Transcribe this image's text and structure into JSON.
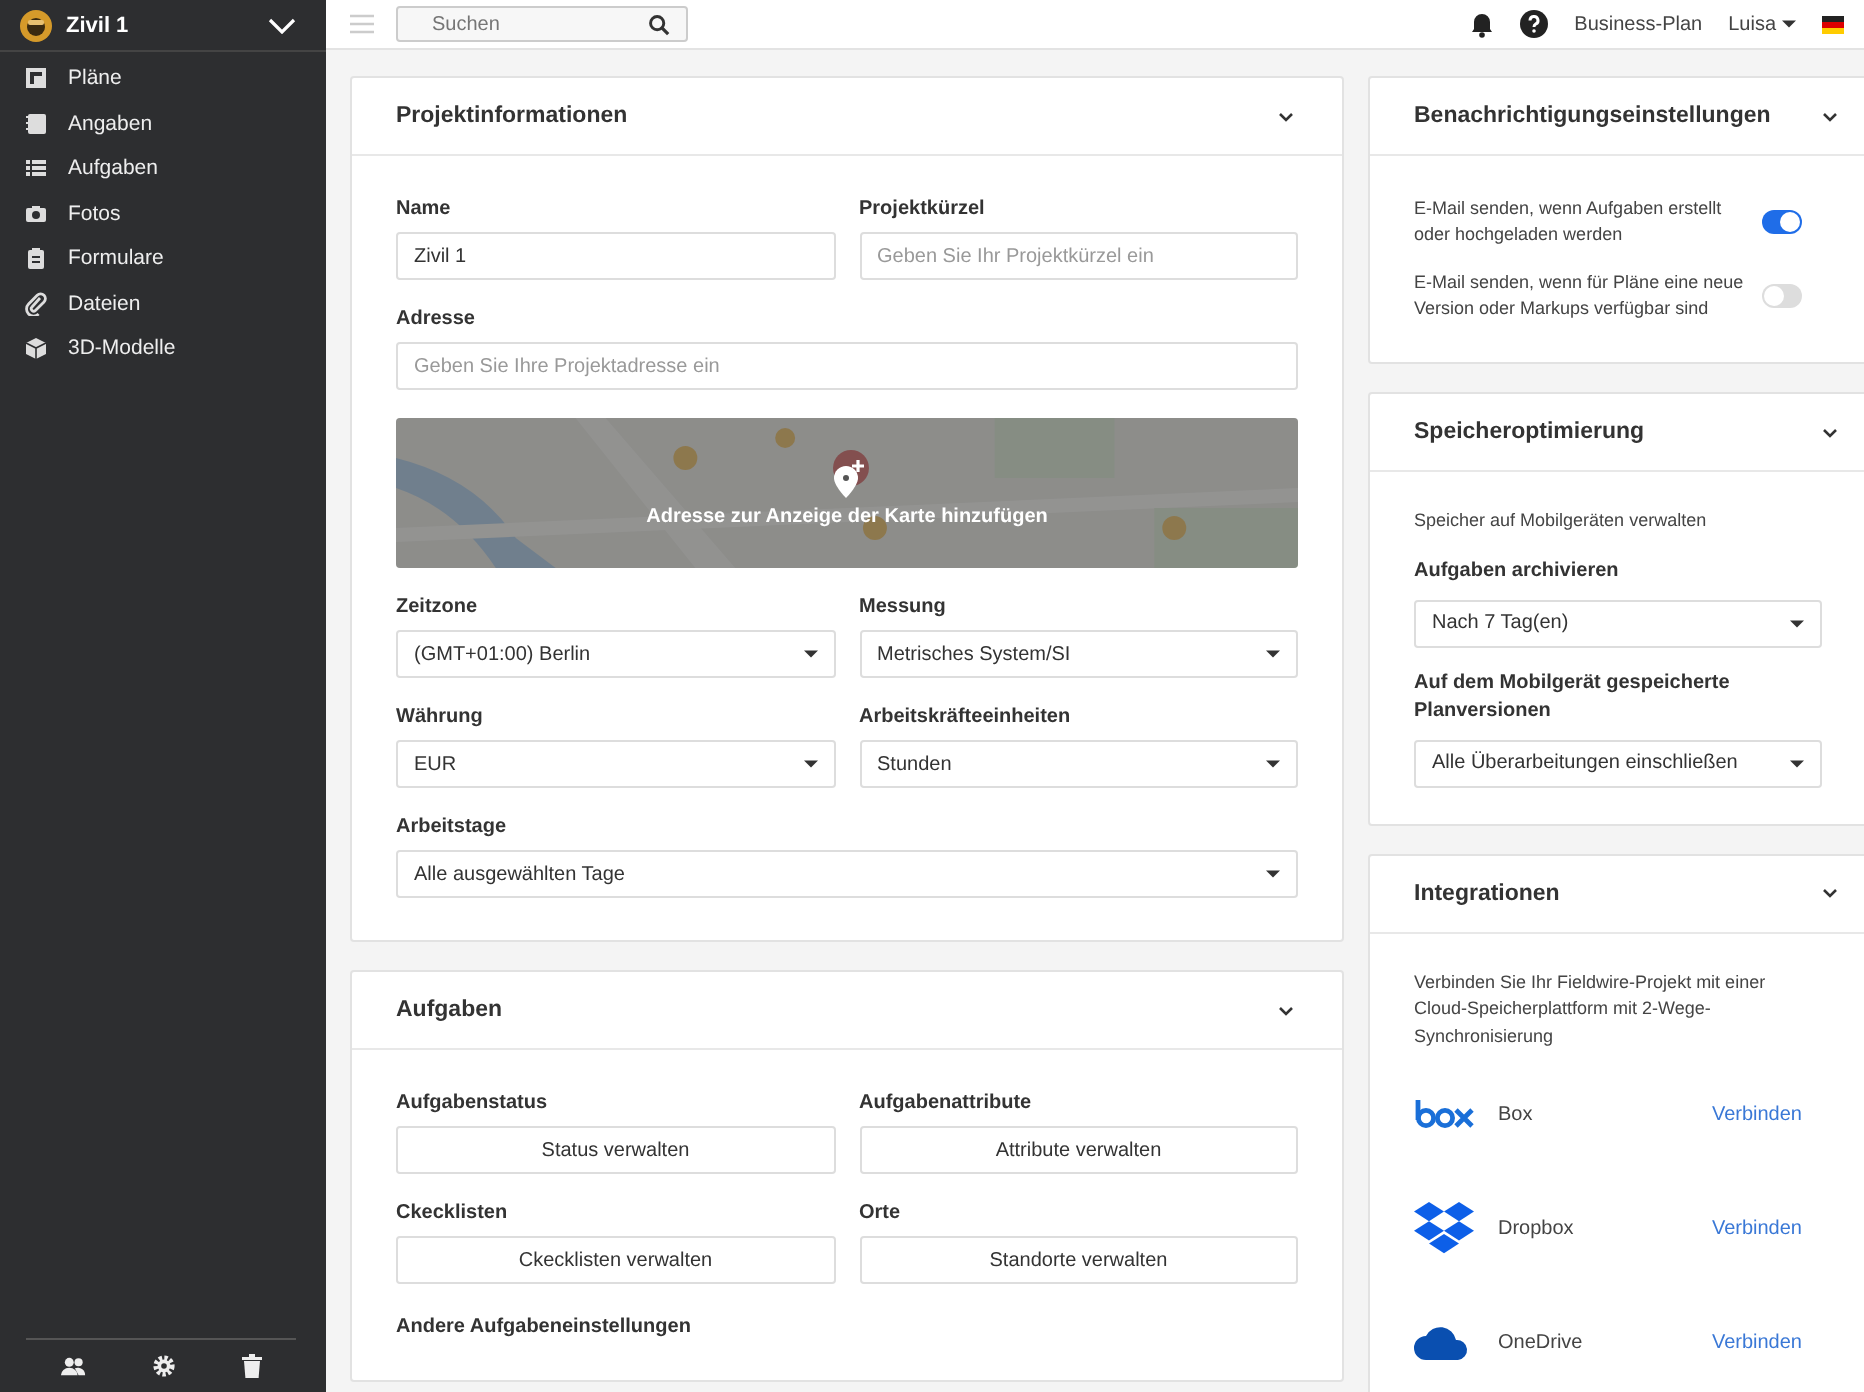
{
  "project": {
    "name": "Zivil 1"
  },
  "sidebar": {
    "items": [
      {
        "label": "Pläne"
      },
      {
        "label": "Angaben"
      },
      {
        "label": "Aufgaben"
      },
      {
        "label": "Fotos"
      },
      {
        "label": "Formulare"
      },
      {
        "label": "Dateien"
      },
      {
        "label": "3D-Modelle"
      }
    ]
  },
  "topbar": {
    "search": {
      "placeholder": "Suchen"
    },
    "plan": "Business-Plan",
    "user": "Luisa"
  },
  "project_info": {
    "title": "Projektinformationen",
    "rows": [
      [
        {
          "label": "Name",
          "kind": "text",
          "value": "Zivil 1"
        },
        {
          "label": "Projektkürzel",
          "kind": "text",
          "placeholder": "Geben Sie Ihr Projektkürzel ein"
        }
      ],
      [
        {
          "label": "Adresse",
          "kind": "text",
          "placeholder": "Geben Sie Ihre Projektadresse ein"
        }
      ],
      [
        {
          "kind": "map",
          "caption": "Adresse zur Anzeige der Karte hinzufügen"
        }
      ],
      [
        {
          "label": "Zeitzone",
          "kind": "select",
          "value": "(GMT+01:00) Berlin"
        },
        {
          "label": "Messung",
          "kind": "select",
          "value": "Metrisches System/SI"
        }
      ],
      [
        {
          "label": "Währung",
          "kind": "select",
          "value": "EUR"
        },
        {
          "label": "Arbeitskräfteeinheiten",
          "kind": "select",
          "value": "Stunden"
        }
      ],
      [
        {
          "label": "Arbeitstage",
          "kind": "select",
          "value": "Alle ausgewählten Tage"
        }
      ]
    ]
  },
  "tasks_card": {
    "title": "Aufgaben",
    "rows": [
      [
        {
          "label": "Aufgabenstatus",
          "kind": "button",
          "value": "Status verwalten"
        },
        {
          "label": "Aufgabenattribute",
          "kind": "button",
          "value": "Attribute verwalten"
        }
      ],
      [
        {
          "label": "Ckecklisten",
          "kind": "button",
          "value": "Ckecklisten verwalten"
        },
        {
          "label": "Orte",
          "kind": "button",
          "value": "Standorte verwalten"
        }
      ],
      [
        {
          "label": "Andere Aufgabeneinstellungen",
          "kind": "heading"
        }
      ]
    ]
  },
  "notifications": {
    "title": "Benachrichtigungseinstellungen",
    "toggles": [
      {
        "label": "E-Mail senden, wenn Aufgaben erstellt oder hochgeladen werden",
        "on": true
      },
      {
        "label": "E-Mail senden, wenn für Pläne eine neue Version oder Markups verfügbar sind",
        "on": false
      }
    ]
  },
  "storage": {
    "title": "Speicheroptimierung",
    "intro": "Speicher auf Mobilgeräten verwalten",
    "fields": [
      {
        "label": "Aufgaben archivieren",
        "value": "Nach 7 Tag(en)"
      },
      {
        "label": "Auf dem Mobilgerät gespeicherte Planversionen",
        "value": "Alle Überarbeitungen einschließen"
      }
    ]
  },
  "integrations": {
    "title": "Integrationen",
    "intro": "Verbinden Sie Ihr Fieldwire-Projekt mit einer Cloud-Speicherplattform mit 2-Wege-Synchronisierung",
    "services": [
      {
        "name": "Box",
        "action": "Verbinden"
      },
      {
        "name": "Dropbox",
        "action": "Verbinden"
      },
      {
        "name": "OneDrive",
        "action": "Verbinden"
      }
    ]
  }
}
